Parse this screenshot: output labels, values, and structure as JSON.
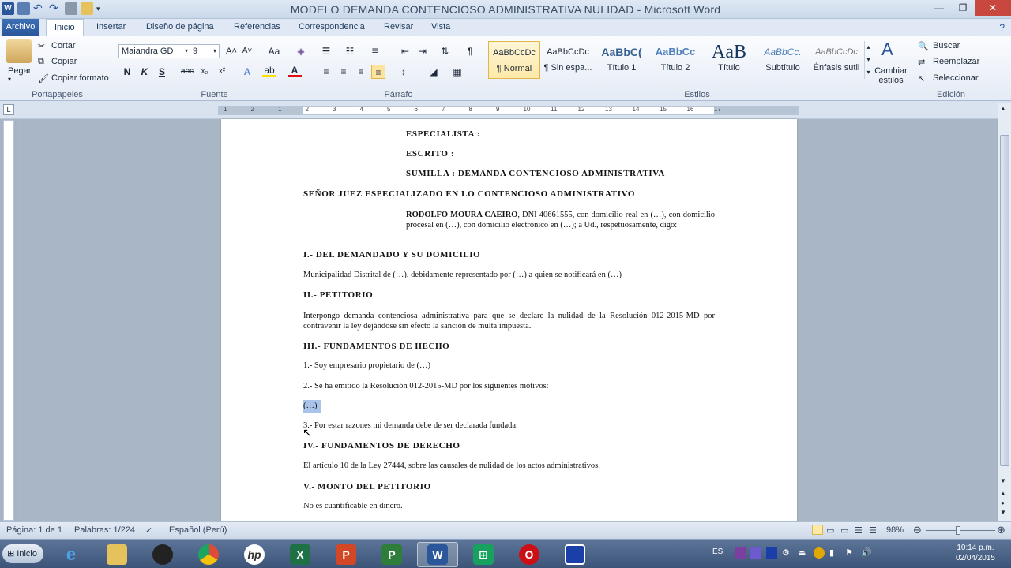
{
  "window": {
    "title": "MODELO DEMANDA CONTENCIOSO ADMINISTRATIVA NULIDAD  -  Microsoft Word"
  },
  "tabs": [
    "Archivo",
    "Inicio",
    "Insertar",
    "Diseño de página",
    "Referencias",
    "Correspondencia",
    "Revisar",
    "Vista"
  ],
  "clipboard": {
    "paste": "Pegar",
    "cut": "Cortar",
    "copy": "Copiar",
    "format_painter": "Copiar formato",
    "label": "Portapapeles"
  },
  "font": {
    "name": "Maiandra GD",
    "size": "9",
    "label": "Fuente",
    "bold": "N",
    "italic": "K",
    "underline": "S",
    "strike": "abc",
    "sub": "x₂",
    "sup": "x²",
    "grow": "A˄",
    "shrink": "A˅",
    "case": "Aa"
  },
  "paragraph": {
    "label": "Párrafo",
    "pilcrow": "¶"
  },
  "styles": {
    "label": "Estilos",
    "items": [
      {
        "sample": "AaBbCcDc",
        "name": "¶ Normal"
      },
      {
        "sample": "AaBbCcDc",
        "name": "¶ Sin espa..."
      },
      {
        "sample": "AaBbC(",
        "name": "Título 1"
      },
      {
        "sample": "AaBbCc",
        "name": "Título 2"
      },
      {
        "sample": "AaB",
        "name": "Título"
      },
      {
        "sample": "AaBbCc.",
        "name": "Subtítulo"
      },
      {
        "sample": "AaBbCcDc",
        "name": "Énfasis sutil"
      }
    ],
    "change": "Cambiar estilos"
  },
  "editing": {
    "label": "Edición",
    "find": "Buscar",
    "replace": "Reemplazar",
    "select": "Seleccionar"
  },
  "ruler_numbers": [
    "1",
    "2",
    "1",
    "2",
    "3",
    "4",
    "5",
    "6",
    "7",
    "8",
    "9",
    "10",
    "11",
    "12",
    "13",
    "14",
    "15",
    "16",
    "17"
  ],
  "document": {
    "especialista": "ESPECIALISTA  :",
    "escrito": "ESCRITO          :",
    "sumilla": "SUMILLA          : DEMANDA CONTENCIOSO ADMINISTRATIVA",
    "juez": "SEÑOR JUEZ ESPECIALIZADO EN LO CONTENCIOSO ADMINISTRATIVO",
    "intro_name": "RODOLFO MOURA CAEIRO",
    "intro_rest": ", DNI 40661555,  con domicilio real en (…), con domicilio procesal en (…), con domicilio electrónico en (…); a Ud., respetuosamente, digo:",
    "h1": "I.- DEL DEMANDADO Y SU DOMICILIO",
    "p1": "Municipalidad Distrital de (…), debidamente representado por (…) a quien se notificará en (…)",
    "h2": "II.- PETITORIO",
    "p2": "Interpongo demanda contenciosa administrativa para que se declare la nulidad de la Resolución 012-2015-MD por contravenir la ley dejándose sin efecto la sanción de multa impuesta.",
    "h3": "III.- FUNDAMENTOS DE HECHO",
    "p3a": "1.- Soy empresario propietario de (…)",
    "p3b": "2.- Se ha emitido la Resolución 012-2015-MD por los siguientes motivos:",
    "p3c": "(…)",
    "p3d": "3.- Por estar razones mi demanda debe de ser declarada fundada.",
    "h4": "IV.- FUNDAMENTOS DE DERECHO",
    "p4": "El artículo 10 de la Ley 27444, sobre las causales de nulidad de los actos administrativos.",
    "h5": "V.- MONTO DEL PETITORIO",
    "p5": "No es cuantificable en dinero."
  },
  "status": {
    "page": "Página: 1 de 1",
    "words": "Palabras: 1/224",
    "language": "Español (Perú)",
    "zoom": "98%"
  },
  "taskbar": {
    "start": "Inicio",
    "lang": "ES",
    "time": "10:14 p.m.",
    "date": "02/04/2015"
  },
  "colors": {
    "word_blue": "#2b579a",
    "excel_green": "#1e7145",
    "ppt_orange": "#d24726",
    "opera_red": "#cc0f16",
    "chrome": "#dd4b39"
  }
}
